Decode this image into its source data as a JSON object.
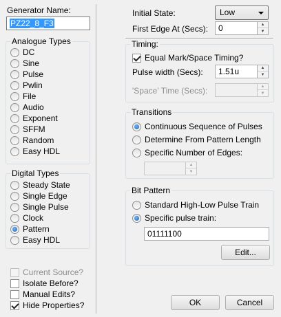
{
  "generator": {
    "name_label": "Generator Name:",
    "name_value": "PZ22_8_F3"
  },
  "analogue": {
    "title": "Analogue Types",
    "options": [
      "DC",
      "Sine",
      "Pulse",
      "Pwlin",
      "File",
      "Audio",
      "Exponent",
      "SFFM",
      "Random",
      "Easy HDL"
    ]
  },
  "digital": {
    "title": "Digital Types",
    "options": [
      "Steady State",
      "Single Edge",
      "Single Pulse",
      "Clock",
      "Pattern",
      "Easy HDL"
    ],
    "selected": "Pattern"
  },
  "options": {
    "current_source": "Current Source?",
    "isolate_before": "Isolate Before?",
    "manual_edits": "Manual Edits?",
    "hide_properties": "Hide Properties?"
  },
  "initial_state": {
    "label": "Initial State:",
    "value": "Low"
  },
  "first_edge": {
    "label": "First Edge At (Secs):",
    "value": "0"
  },
  "timing": {
    "title": "Timing:",
    "equal_mark_space": "Equal Mark/Space Timing?",
    "pulse_width_label": "Pulse width (Secs):",
    "pulse_width_value": "1.51u",
    "space_time_label": "'Space' Time (Secs):",
    "space_time_value": ""
  },
  "transitions": {
    "title": "Transitions",
    "options": [
      "Continuous Sequence of Pulses",
      "Determine From Pattern Length",
      "Specific Number of Edges:"
    ],
    "selected": "Continuous Sequence of Pulses",
    "edges_value": ""
  },
  "bit_pattern": {
    "title": "Bit Pattern",
    "options": [
      "Standard High-Low Pulse Train",
      "Specific pulse train:"
    ],
    "selected": "Specific pulse train:",
    "pattern_value": "01111100",
    "edit_label": "Edit..."
  },
  "buttons": {
    "ok": "OK",
    "cancel": "Cancel"
  }
}
